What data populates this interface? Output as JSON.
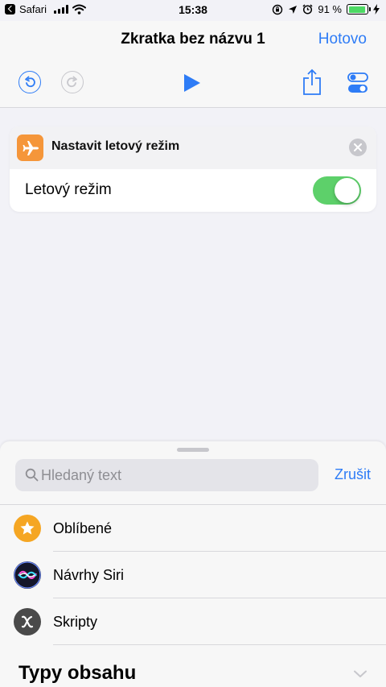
{
  "status_bar": {
    "back_app": "Safari",
    "time": "15:38",
    "battery_percent": "91 %",
    "battery_level": 0.91,
    "icons": [
      "back-arrow-icon",
      "signal-icon",
      "wifi-icon",
      "rotation-lock-icon",
      "location-icon",
      "alarm-icon",
      "battery-icon",
      "charging-icon"
    ]
  },
  "nav": {
    "title": "Zkratka bez názvu 1",
    "done_label": "Hotovo",
    "toolbar_icons": [
      "undo-icon",
      "redo-icon",
      "play-icon",
      "share-icon",
      "settings-toggles-icon"
    ],
    "redo_enabled": false
  },
  "action": {
    "title": "Nastavit letový režim",
    "icon": "airplane-icon",
    "param_label": "Letový režim",
    "toggle_on": true
  },
  "sheet": {
    "search_placeholder": "Hledaný text",
    "search_value": "",
    "cancel_label": "Zrušit",
    "categories": [
      {
        "label": "Oblíbené",
        "icon": "star-icon"
      },
      {
        "label": "Návrhy Siri",
        "icon": "siri-icon"
      },
      {
        "label": "Skripty",
        "icon": "script-x-icon"
      }
    ],
    "section_title": "Typy obsahu"
  },
  "colors": {
    "accent": "#2e7cf6",
    "toggle_on": "#5dd06a",
    "action_icon_bg": "#f5963a",
    "favorites_icon_bg": "#f5a623",
    "scripts_icon_bg": "#4a4a4a"
  }
}
